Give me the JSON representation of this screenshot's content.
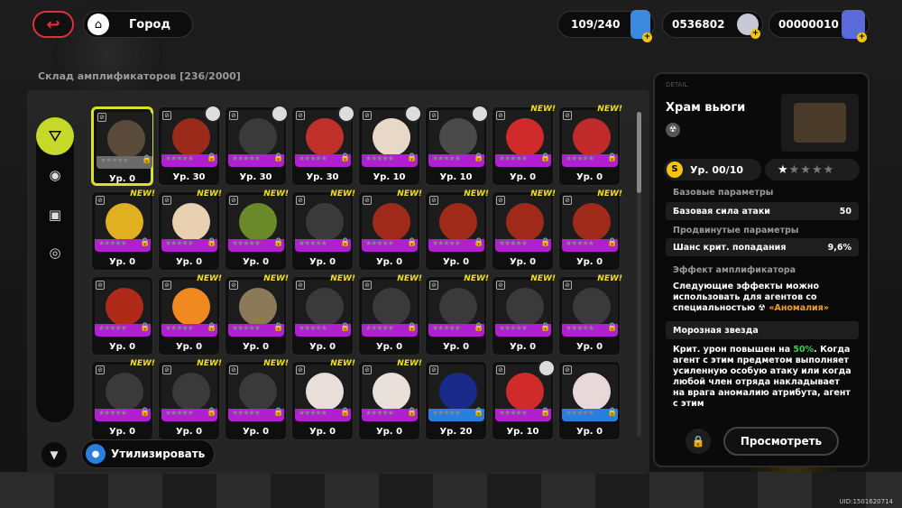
{
  "topbar": {
    "home_label": "Город",
    "stamina": "109/240",
    "currency1": "0536802",
    "currency2": "00000010"
  },
  "storage": {
    "title": "Склад амплификаторов [236/2000]"
  },
  "colors": {
    "accent": "#d9e22a",
    "new": "#f2e020",
    "purple": "#b020d0",
    "blue": "#2a7ee0"
  },
  "cards": [
    {
      "lv": "Ур. 0",
      "new": "",
      "band": "#6a6a6a",
      "ball": "#5a4a3a",
      "sel": true,
      "avatar": false
    },
    {
      "lv": "Ур. 30",
      "new": "",
      "band": "#b020d0",
      "ball": "#9a2a1a",
      "avatar": true
    },
    {
      "lv": "Ур. 30",
      "new": "",
      "band": "#b020d0",
      "ball": "#3a3a3a",
      "avatar": true
    },
    {
      "lv": "Ур. 30",
      "new": "",
      "band": "#b020d0",
      "ball": "#c0302a",
      "avatar": true
    },
    {
      "lv": "Ур. 10",
      "new": "",
      "band": "#b020d0",
      "ball": "#e8d8c8",
      "avatar": true
    },
    {
      "lv": "Ур. 10",
      "new": "",
      "band": "#b020d0",
      "ball": "#4a4a4a",
      "avatar": true
    },
    {
      "lv": "Ур. 0",
      "new": "NEW!",
      "band": "#b020d0",
      "ball": "#d02a2a"
    },
    {
      "lv": "Ур. 0",
      "new": "NEW!",
      "band": "#b020d0",
      "ball": "#c02a2a"
    },
    {
      "lv": "Ур. 0",
      "new": "NEW!",
      "band": "#b020d0",
      "ball": "#e0b020"
    },
    {
      "lv": "Ур. 0",
      "new": "NEW!",
      "band": "#b020d0",
      "ball": "#e8d0b0"
    },
    {
      "lv": "Ур. 0",
      "new": "NEW!",
      "band": "#b020d0",
      "ball": "#6a8a2a"
    },
    {
      "lv": "Ур. 0",
      "new": "NEW!",
      "band": "#b020d0",
      "ball": "#3a3a3a"
    },
    {
      "lv": "Ур. 0",
      "new": "NEW!",
      "band": "#b020d0",
      "ball": "#a02a1a"
    },
    {
      "lv": "Ур. 0",
      "new": "NEW!",
      "band": "#b020d0",
      "ball": "#a02a1a"
    },
    {
      "lv": "Ур. 0",
      "new": "NEW!",
      "band": "#b020d0",
      "ball": "#a02a1a"
    },
    {
      "lv": "Ур. 0",
      "new": "NEW!",
      "band": "#b020d0",
      "ball": "#a02a1a"
    },
    {
      "lv": "Ур. 0",
      "new": "",
      "band": "#b020d0",
      "ball": "#b02a1a"
    },
    {
      "lv": "Ур. 0",
      "new": "NEW!",
      "band": "#b020d0",
      "ball": "#f08a20"
    },
    {
      "lv": "Ур. 0",
      "new": "NEW!",
      "band": "#b020d0",
      "ball": "#8a7a5a"
    },
    {
      "lv": "Ур. 0",
      "new": "NEW!",
      "band": "#b020d0",
      "ball": "#3a3a3a"
    },
    {
      "lv": "Ур. 0",
      "new": "NEW!",
      "band": "#b020d0",
      "ball": "#3a3a3a"
    },
    {
      "lv": "Ур. 0",
      "new": "NEW!",
      "band": "#b020d0",
      "ball": "#3a3a3a"
    },
    {
      "lv": "Ур. 0",
      "new": "NEW!",
      "band": "#b020d0",
      "ball": "#3a3a3a"
    },
    {
      "lv": "Ур. 0",
      "new": "NEW!",
      "band": "#b020d0",
      "ball": "#3a3a3a"
    },
    {
      "lv": "Ур. 0",
      "new": "NEW!",
      "band": "#b020d0",
      "ball": "#3a3a3a"
    },
    {
      "lv": "Ур. 0",
      "new": "NEW!",
      "band": "#b020d0",
      "ball": "#3a3a3a"
    },
    {
      "lv": "Ур. 0",
      "new": "NEW!",
      "band": "#b020d0",
      "ball": "#3a3a3a"
    },
    {
      "lv": "Ур. 0",
      "new": "NEW!",
      "band": "#b020d0",
      "ball": "#e8e0d8"
    },
    {
      "lv": "Ур. 0",
      "new": "NEW!",
      "band": "#b020d0",
      "ball": "#e8e0d8"
    },
    {
      "lv": "Ур. 20",
      "new": "",
      "band": "#2a7ee0",
      "ball": "#1a2a8a"
    },
    {
      "lv": "Ур. 10",
      "new": "",
      "band": "#b020d0",
      "ball": "#d02a2a",
      "avatar": true
    },
    {
      "lv": "Ур. 0",
      "new": "",
      "band": "#2a7ee0",
      "ball": "#e8d8d8"
    }
  ],
  "detail": {
    "label": "DETAIL",
    "name": "Храм вьюги",
    "level": "Ур. 00/10",
    "base_title": "Базовые параметры",
    "base_stat": "Базовая сила атаки",
    "base_val": "50",
    "adv_title": "Продвинутые параметры",
    "adv_stat": "Шанс крит. попадания",
    "adv_val": "9,6%",
    "effect_title": "Эффект амплификатора",
    "effect_text_a": "Следующие эффекты можно использовать для агентов со специальностью",
    "effect_spec": "«Аномалия»",
    "skill_name": "Морозная звезда",
    "skill_text_a": "Крит. урон повышен на",
    "skill_pct": "50%",
    "skill_text_b": ". Когда агент с этим предметом выполняет усиленную особую атаку или когда любой член отряда накладывает на врага аномалию атрибута, агент с этим",
    "view": "Просмотреть"
  },
  "bottom": {
    "dispose": "Утилизировать"
  },
  "uid": "UID:1501620714"
}
